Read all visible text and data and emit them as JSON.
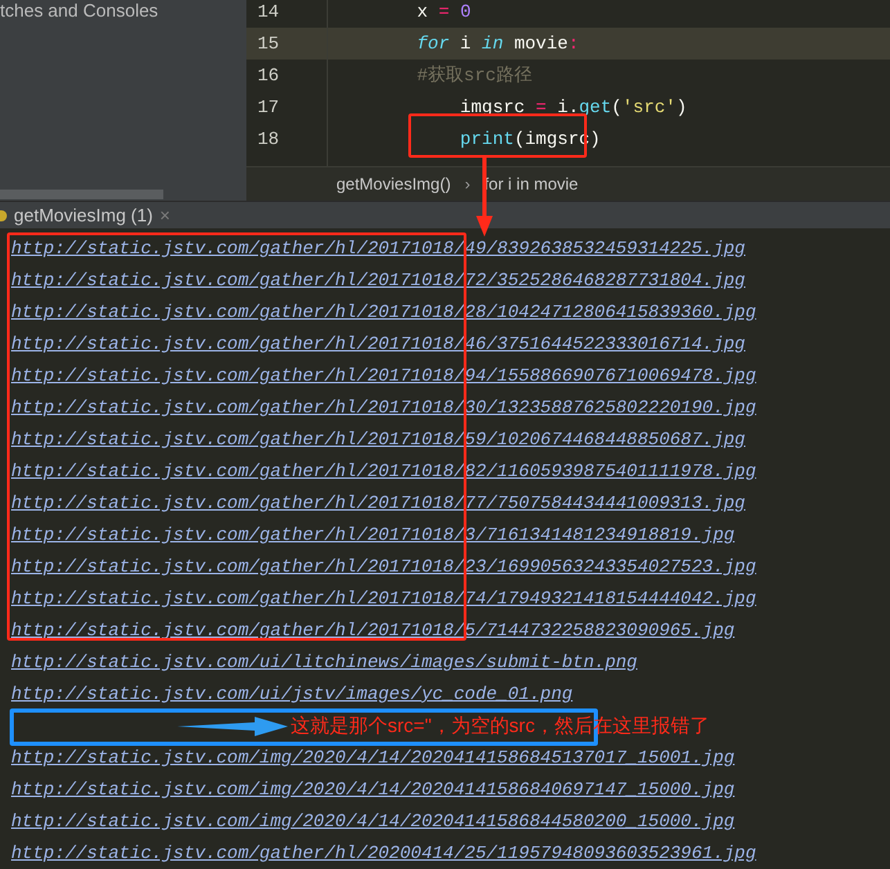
{
  "project_panel": {
    "title": "tches and Consoles"
  },
  "editor": {
    "lines": [
      {
        "number": "14",
        "current": false,
        "tokens": [
          {
            "kind": "plain",
            "text": "    x "
          },
          {
            "kind": "op",
            "text": "="
          },
          {
            "kind": "num",
            "text": " 0"
          }
        ]
      },
      {
        "number": "15",
        "current": true,
        "tokens": [
          {
            "kind": "keyword",
            "text": "    for"
          },
          {
            "kind": "plain",
            "text": " i "
          },
          {
            "kind": "keyword",
            "text": "in"
          },
          {
            "kind": "plain",
            "text": " movie"
          },
          {
            "kind": "op",
            "text": ":"
          }
        ]
      },
      {
        "number": "16",
        "current": false,
        "tokens": [
          {
            "kind": "comment",
            "text": "    #获取src路径"
          }
        ]
      },
      {
        "number": "17",
        "current": false,
        "tokens": [
          {
            "kind": "plain",
            "text": "        imgsrc "
          },
          {
            "kind": "op",
            "text": "="
          },
          {
            "kind": "plain",
            "text": " i."
          },
          {
            "kind": "func",
            "text": "get"
          },
          {
            "kind": "plain",
            "text": "("
          },
          {
            "kind": "string",
            "text": "'src'"
          },
          {
            "kind": "plain",
            "text": ")"
          }
        ]
      },
      {
        "number": "18",
        "current": false,
        "tokens": [
          {
            "kind": "func",
            "text": "        print"
          },
          {
            "kind": "plain",
            "text": "(imgsrc)"
          }
        ]
      }
    ]
  },
  "breadcrumbs": {
    "items": [
      "getMoviesImg()",
      "for i in movie"
    ],
    "separator": "›"
  },
  "console_tab": {
    "label": "getMoviesImg (1)",
    "close": "×"
  },
  "output": [
    {
      "kind": "url",
      "text": "http://static.jstv.com/gather/hl/20171018/49/8392638532459314225.jpg"
    },
    {
      "kind": "url",
      "text": "http://static.jstv.com/gather/hl/20171018/72/3525286468287731804.jpg"
    },
    {
      "kind": "url",
      "text": "http://static.jstv.com/gather/hl/20171018/28/10424712806415839360.jpg"
    },
    {
      "kind": "url",
      "text": "http://static.jstv.com/gather/hl/20171018/46/3751644522333016714.jpg"
    },
    {
      "kind": "url",
      "text": "http://static.jstv.com/gather/hl/20171018/94/15588669076710069478.jpg"
    },
    {
      "kind": "url",
      "text": "http://static.jstv.com/gather/hl/20171018/30/13235887625802220190.jpg"
    },
    {
      "kind": "url",
      "text": "http://static.jstv.com/gather/hl/20171018/59/1020674468448850687.jpg"
    },
    {
      "kind": "url",
      "text": "http://static.jstv.com/gather/hl/20171018/82/11605939875401111978.jpg"
    },
    {
      "kind": "url",
      "text": "http://static.jstv.com/gather/hl/20171018/77/7507584434441009313.jpg"
    },
    {
      "kind": "url",
      "text": "http://static.jstv.com/gather/hl/20171018/3/7161341481234918819.jpg"
    },
    {
      "kind": "url",
      "text": "http://static.jstv.com/gather/hl/20171018/23/16990563243354027523.jpg"
    },
    {
      "kind": "url",
      "text": "http://static.jstv.com/gather/hl/20171018/74/17949321418154444042.jpg"
    },
    {
      "kind": "url",
      "text": "http://static.jstv.com/gather/hl/20171018/5/7144732258823090965.jpg"
    },
    {
      "kind": "url",
      "text": "http://static.jstv.com/ui/litchinews/images/submit-btn.png"
    },
    {
      "kind": "url",
      "text": "http://static.jstv.com/ui/jstv/images/yc_code_01.png"
    },
    {
      "kind": "blank",
      "callout": "这就是那个src=\"，为空的src，然后在这里报错了"
    },
    {
      "kind": "url",
      "text": "http://static.jstv.com/img/2020/4/14/20204141586845137017_15001.jpg"
    },
    {
      "kind": "url",
      "text": "http://static.jstv.com/img/2020/4/14/20204141586840697147_15000.jpg"
    },
    {
      "kind": "url",
      "text": "http://static.jstv.com/img/2020/4/14/20204141586844580200_15000.jpg"
    },
    {
      "kind": "url",
      "text": "http://static.jstv.com/gather/hl/20200414/25/11957948093603523961.jpg"
    }
  ]
}
